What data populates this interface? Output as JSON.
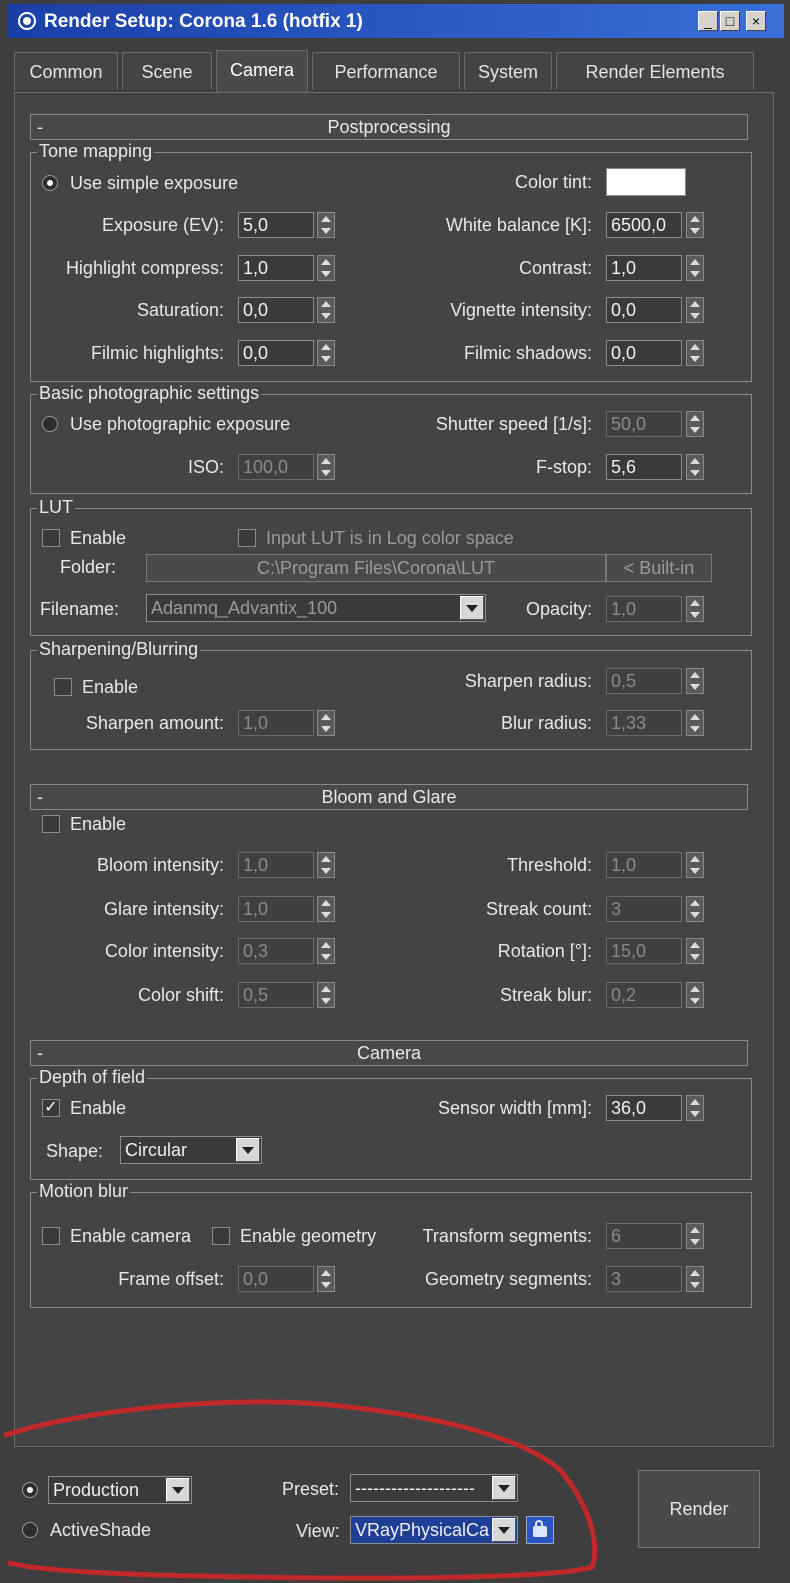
{
  "window": {
    "title": "Render Setup: Corona 1.6 (hotfix 1)",
    "minimize": "_",
    "maximize": "□",
    "close": "×"
  },
  "tabs": [
    "Common",
    "Scene",
    "Camera",
    "Performance",
    "System",
    "Render Elements"
  ],
  "postprocessing": {
    "title": "Postprocessing",
    "collapse": "-",
    "tone_mapping": {
      "legend": "Tone mapping",
      "use_simple": "Use simple exposure",
      "color_tint": "Color tint:",
      "color_tint_value": "#ffffff",
      "exposure_label": "Exposure (EV):",
      "exposure": "5,0",
      "white_balance_label": "White balance [K]:",
      "white_balance": "6500,0",
      "highlight_label": "Highlight compress:",
      "highlight": "1,0",
      "contrast_label": "Contrast:",
      "contrast": "1,0",
      "saturation_label": "Saturation:",
      "saturation": "0,0",
      "vignette_label": "Vignette intensity:",
      "vignette": "0,0",
      "filmic_high_label": "Filmic highlights:",
      "filmic_high": "0,0",
      "filmic_shadow_label": "Filmic shadows:",
      "filmic_shadow": "0,0"
    },
    "photographic": {
      "legend": "Basic photographic settings",
      "use_photo": "Use photographic exposure",
      "shutter_label": "Shutter speed [1/s]:",
      "shutter": "50,0",
      "iso_label": "ISO:",
      "iso": "100,0",
      "fstop_label": "F-stop:",
      "fstop": "5,6"
    },
    "lut": {
      "legend": "LUT",
      "enable": "Enable",
      "log_space": "Input LUT is in Log color space",
      "folder_label": "Folder:",
      "folder": "C:\\Program Files\\Corona\\LUT",
      "builtin": "< Built-in",
      "filename_label": "Filename:",
      "filename": "Adanmq_Advantix_100",
      "opacity_label": "Opacity:",
      "opacity": "1,0"
    },
    "sharpen": {
      "legend": "Sharpening/Blurring",
      "enable": "Enable",
      "radius_label": "Sharpen radius:",
      "radius": "0,5",
      "amount_label": "Sharpen amount:",
      "amount": "1,0",
      "blur_label": "Blur radius:",
      "blur": "1,33"
    }
  },
  "bloom": {
    "title": "Bloom and Glare",
    "collapse": "-",
    "enable": "Enable",
    "bloom_label": "Bloom intensity:",
    "bloom": "1,0",
    "threshold_label": "Threshold:",
    "threshold": "1,0",
    "glare_label": "Glare intensity:",
    "glare": "1,0",
    "streak_count_label": "Streak count:",
    "streak_count": "3",
    "color_int_label": "Color intensity:",
    "color_int": "0,3",
    "rotation_label": "Rotation  [°]:",
    "rotation": "15,0",
    "color_shift_label": "Color shift:",
    "color_shift": "0,5",
    "streak_blur_label": "Streak blur:",
    "streak_blur": "0,2"
  },
  "camera": {
    "title": "Camera",
    "collapse": "-",
    "dof": {
      "legend": "Depth of field",
      "enable": "Enable",
      "check": "✓",
      "sensor_label": "Sensor width [mm]:",
      "sensor": "36,0",
      "shape_label": "Shape:",
      "shape": "Circular"
    },
    "motion": {
      "legend": "Motion blur",
      "enable_camera": "Enable camera",
      "enable_geometry": "Enable geometry",
      "transform_label": "Transform segments:",
      "transform": "6",
      "offset_label": "Frame offset:",
      "offset": "0,0",
      "geometry_label": "Geometry segments:",
      "geometry": "3"
    }
  },
  "footer": {
    "production": "Production",
    "activeshade": "ActiveShade",
    "preset_label": "Preset:",
    "preset": "--------------------",
    "view_label": "View:",
    "view": "VRayPhysicalCa",
    "render": "Render"
  },
  "colors": {
    "title_bar": "#2a56c4",
    "panel": "#444444",
    "annotation": "#c0282a"
  }
}
